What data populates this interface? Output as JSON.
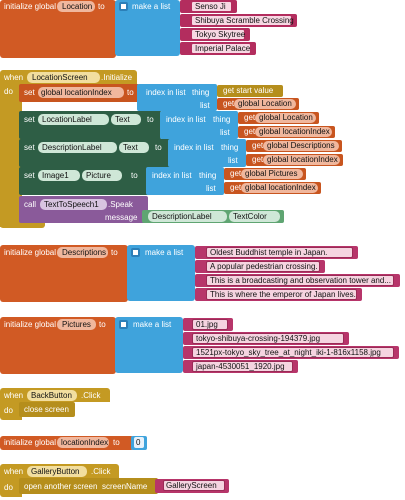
{
  "blocks": {
    "init_location": {
      "kw_initialize": "initialize global",
      "var_name": "Location",
      "kw_to": "to",
      "kw_make_list": "make a list",
      "items": [
        "Senso Ji",
        "Shibuya Scramble Crossing",
        "Tokyo Skytree",
        "Imperial Palace"
      ]
    },
    "location_screen_init": {
      "kw_when": "when",
      "component": "LocationScreen",
      "event": ".Initialize",
      "kw_do": "do",
      "kw_set": "set",
      "kw_to": "to",
      "kw_index_in_list": "index in list",
      "kw_thing": "thing",
      "kw_list": "list",
      "kw_get_start_value": "get start value",
      "kw_get": "get",
      "kw_call": "call",
      "kw_message": "message",
      "lines": [
        {
          "target": "global locationIndex",
          "thing": "get start value",
          "list": "global Location"
        },
        {
          "component": "LocationLabel",
          "property": "Text",
          "thing": "global Location",
          "list": "global locationIndex"
        },
        {
          "component": "DescriptionLabel",
          "property": "Text",
          "thing": "global Descriptions",
          "list": "global locationIndex"
        },
        {
          "component": "Image1",
          "property": "Picture",
          "thing": "global Pictures",
          "list": "global locationIndex"
        }
      ],
      "speak_component": "TextToSpeech1",
      "speak_method": ".Speak",
      "message_component": "DescriptionLabel",
      "message_property": "TextColor"
    },
    "init_descriptions": {
      "kw_initialize": "initialize global",
      "var_name": "Descriptions",
      "kw_to": "to",
      "kw_make_list": "make a list",
      "items": [
        "Oldest Buddhist temple in Japan.",
        "A popular pedestrian crossing.",
        "This is a broadcasting and observation tower and...",
        "This is where the emperor of Japan lives."
      ]
    },
    "init_pictures": {
      "kw_initialize": "initialize global",
      "var_name": "Pictures",
      "kw_to": "to",
      "kw_make_list": "make a list",
      "items": [
        "01.jpg",
        "tokyo-shibuya-crossing-194379.jpg",
        "1521px-tokyo_sky_tree_at_night_iki-1-816x1158.jpg",
        "japan-4530051_1920.jpg"
      ]
    },
    "back_button": {
      "kw_when": "when",
      "component": "BackButton",
      "event": ".Click",
      "kw_do": "do",
      "action": "close screen"
    },
    "init_location_index": {
      "kw_initialize": "initialize global",
      "var_name": "locationIndex",
      "kw_to": "to",
      "value": "0"
    },
    "gallery_button": {
      "kw_when": "when",
      "component": "GalleryButton",
      "event": ".Click",
      "kw_do": "do",
      "action": "open another screen",
      "kw_screen_name": "screenName",
      "screen_value": "GalleryScreen"
    }
  },
  "colors": {
    "variables": "#d15a24",
    "lists": "#3fa3dc",
    "text": "#b32d5e",
    "events": "#c49a23",
    "components": "#2e5e45",
    "methods": "#8a5a9a",
    "math": "#3fa3dc"
  }
}
